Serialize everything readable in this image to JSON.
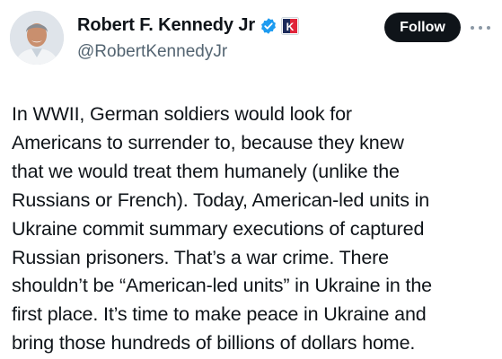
{
  "tweet": {
    "author": {
      "display_name": "Robert F. Kennedy Jr",
      "handle": "@RobertKennedyJr",
      "badge_letters": "K"
    },
    "follow_label": "Follow",
    "text_lines": [
      "In WWII, German soldiers would look for",
      "Americans to surrender to, because they knew",
      "that we would treat them humanely (unlike the",
      "Russians or French). Today, American-led units in",
      "Ukraine commit summary executions of captured",
      "Russian prisoners. That’s a war crime. There",
      "shouldn’t be “American-led units” in Ukraine in the",
      "first place. It’s time to make peace in Ukraine and",
      "bring those hundreds of billions of dollars home."
    ]
  },
  "icons": {
    "verified": "verified-checkmark-icon",
    "affiliate": "campaign-badge-icon",
    "more": "more-horizontal-icon"
  },
  "colors": {
    "verified_blue": "#1d9bf0",
    "follow_bg": "#0f1419",
    "handle_gray": "#536471",
    "badge_red": "#e0243a",
    "badge_navy": "#1c2a5a"
  }
}
